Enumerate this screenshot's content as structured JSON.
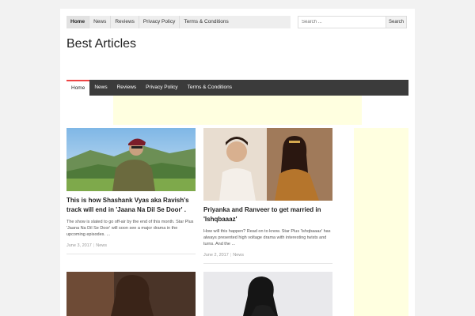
{
  "top_nav": {
    "items": [
      "Home",
      "News",
      "Reviews",
      "Privacy Policy",
      "Terms & Conditions"
    ]
  },
  "search": {
    "placeholder": "Search ...",
    "button_label": "Search"
  },
  "site": {
    "title": "Best Articles"
  },
  "main_nav": {
    "items": [
      "Home",
      "News",
      "Reviews",
      "Privacy Policy",
      "Terms & Conditions"
    ]
  },
  "posts": [
    {
      "title": "This is how Shashank Vyas aka Ravish's track will end in 'Jaana Na Dil Se Door' .",
      "excerpt": "The show is slated to go off-air by the end of this month. Star Plus 'Jaana Na Dil Se Door' will soon see a major drama in the upcoming episodes. ...",
      "date": "June 3, 2017",
      "category": "News"
    },
    {
      "title": "Priyanka and Ranveer to get married in 'Ishqbaaaz'",
      "excerpt": "How will this happen? Read on to know. Star Plus 'Ishqbaaaz' has always presented high voltage drama with interesting twists and turns. And the ...",
      "date": "June 2, 2017",
      "category": "News"
    }
  ],
  "colors": {
    "nav_bg": "#3b3b3b",
    "accent": "#e44444",
    "ad_bg": "#ffffe0"
  }
}
